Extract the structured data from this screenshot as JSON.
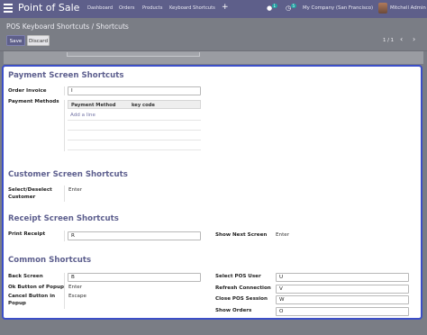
{
  "navbar": {
    "app_name": "Point of Sale",
    "menu": [
      "Dashboard",
      "Orders",
      "Products",
      "Keyboard Shortcuts"
    ],
    "plus": "+",
    "chat_count": "1",
    "activity_count": "5",
    "company": "My Company (San Francisco)",
    "user": "Mitchell Admin"
  },
  "control_panel": {
    "breadcrumb": "POS Keyboard Shortcuts / Shortcuts",
    "save_label": "Save",
    "discard_label": "Discard",
    "pager": "1 / 1",
    "prev": "‹",
    "next": "›"
  },
  "form": {
    "payment": {
      "title": "Payment Screen Shortcuts",
      "order_invoice_label": "Order Invoice",
      "order_invoice_value": "I",
      "payment_methods_label": "Payment Methods",
      "columns": [
        "Payment Method",
        "key code"
      ],
      "add_line": "Add a line"
    },
    "customer": {
      "title": "Customer Screen Shortcuts",
      "select_deselect_label_1": "Select/Deselect",
      "select_deselect_label_2": "Customer",
      "select_deselect_value": "Enter"
    },
    "receipt": {
      "title": "Receipt Screen Shortcuts",
      "print_receipt_label": "Print Receipt",
      "print_receipt_value": "R",
      "show_next_label": "Show Next Screen",
      "show_next_value": "Enter"
    },
    "common": {
      "title": "Common Shortcuts",
      "back_screen_label": "Back Screen",
      "back_screen_value": "B",
      "ok_popup_label": "Ok Button of Popup",
      "ok_popup_value": "Enter",
      "cancel_popup_label_1": "Cancel Button in",
      "cancel_popup_label_2": "Popup",
      "cancel_popup_value": "Escape",
      "select_pos_user_label": "Select POS User",
      "select_pos_user_value": "U",
      "refresh_connection_label": "Refresh Connection",
      "refresh_connection_value": "V",
      "close_pos_session_label": "Close POS Session",
      "close_pos_session_value": "W",
      "show_orders_label": "Show Orders",
      "show_orders_value": "O"
    }
  },
  "colors": {
    "navbar": "#5e5f8a",
    "section_title": "#5d5f8e",
    "focus_border": "#3c4fc8"
  }
}
